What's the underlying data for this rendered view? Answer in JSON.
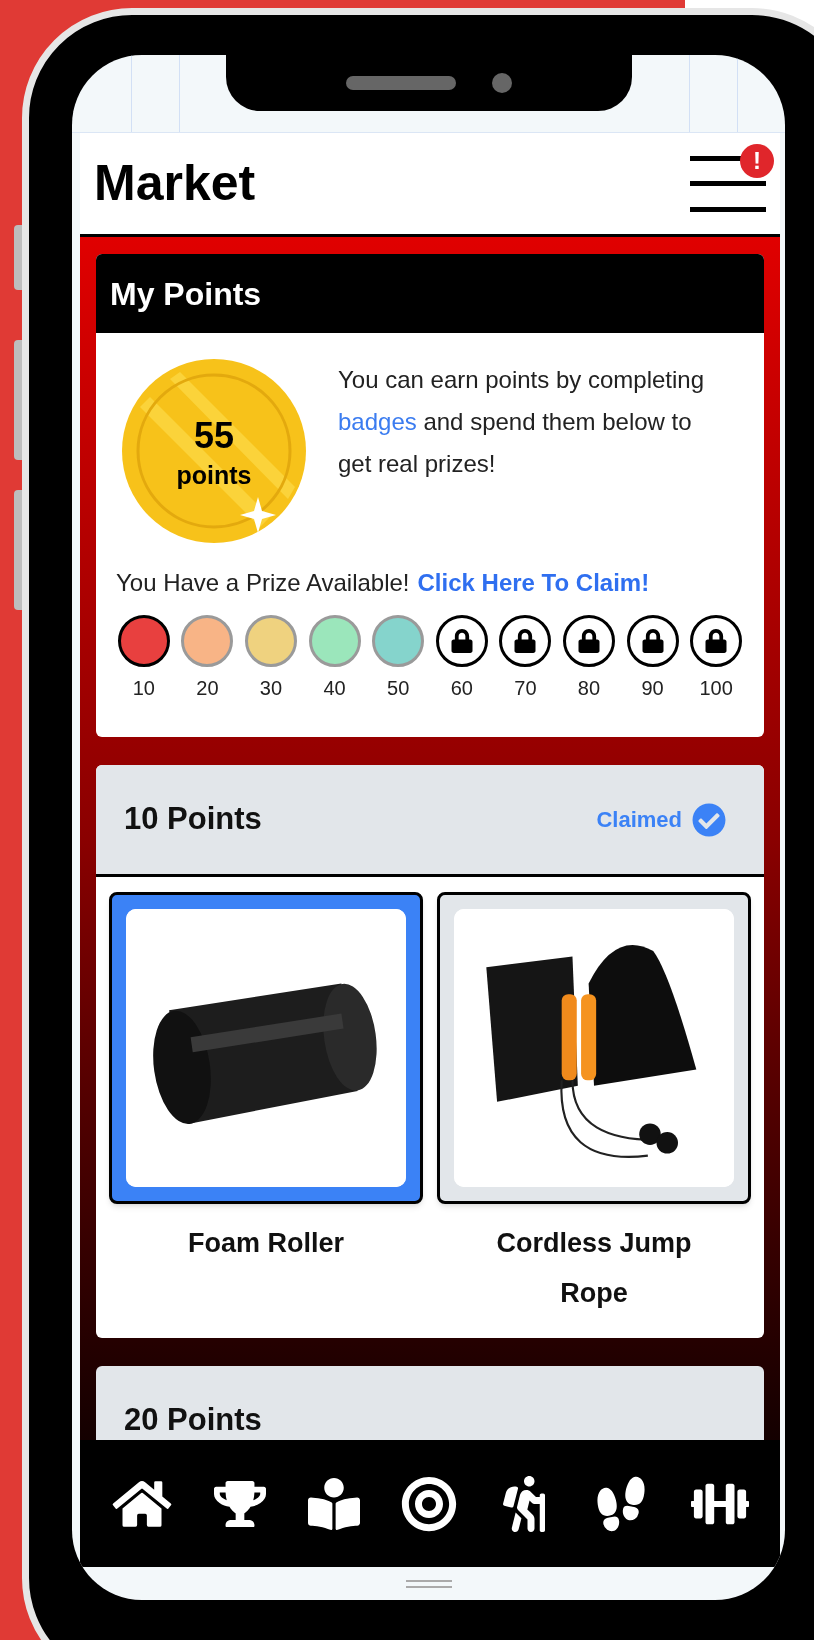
{
  "header": {
    "title": "Market",
    "menu_alert": "!"
  },
  "points_card": {
    "title": "My Points",
    "coin_value": "55",
    "coin_unit": "points",
    "description_before": "You can earn points by completing",
    "description_link": "badges",
    "description_after": "and spend them below to get real prizes!",
    "prize_notice": "You Have a Prize Available!",
    "claim_link": "Click Here To Claim!",
    "milestones": [
      {
        "label": "10",
        "kind": "current",
        "color": "#e8403f"
      },
      {
        "label": "20",
        "kind": "unlocked",
        "color": "#f8b486"
      },
      {
        "label": "30",
        "kind": "unlocked",
        "color": "#efd27f"
      },
      {
        "label": "40",
        "kind": "unlocked",
        "color": "#9be6bb"
      },
      {
        "label": "50",
        "kind": "unlocked",
        "color": "#85d4cc"
      },
      {
        "label": "60",
        "kind": "locked"
      },
      {
        "label": "70",
        "kind": "locked"
      },
      {
        "label": "80",
        "kind": "locked"
      },
      {
        "label": "90",
        "kind": "locked"
      },
      {
        "label": "100",
        "kind": "locked"
      }
    ]
  },
  "tiers": [
    {
      "title": "10 Points",
      "status": "Claimed",
      "prizes": [
        {
          "name": "Foam Roller",
          "kind": "roller",
          "selected": true
        },
        {
          "name": "Cordless Jump Rope",
          "kind": "rope",
          "selected": false
        }
      ]
    },
    {
      "title": "20 Points"
    }
  ]
}
